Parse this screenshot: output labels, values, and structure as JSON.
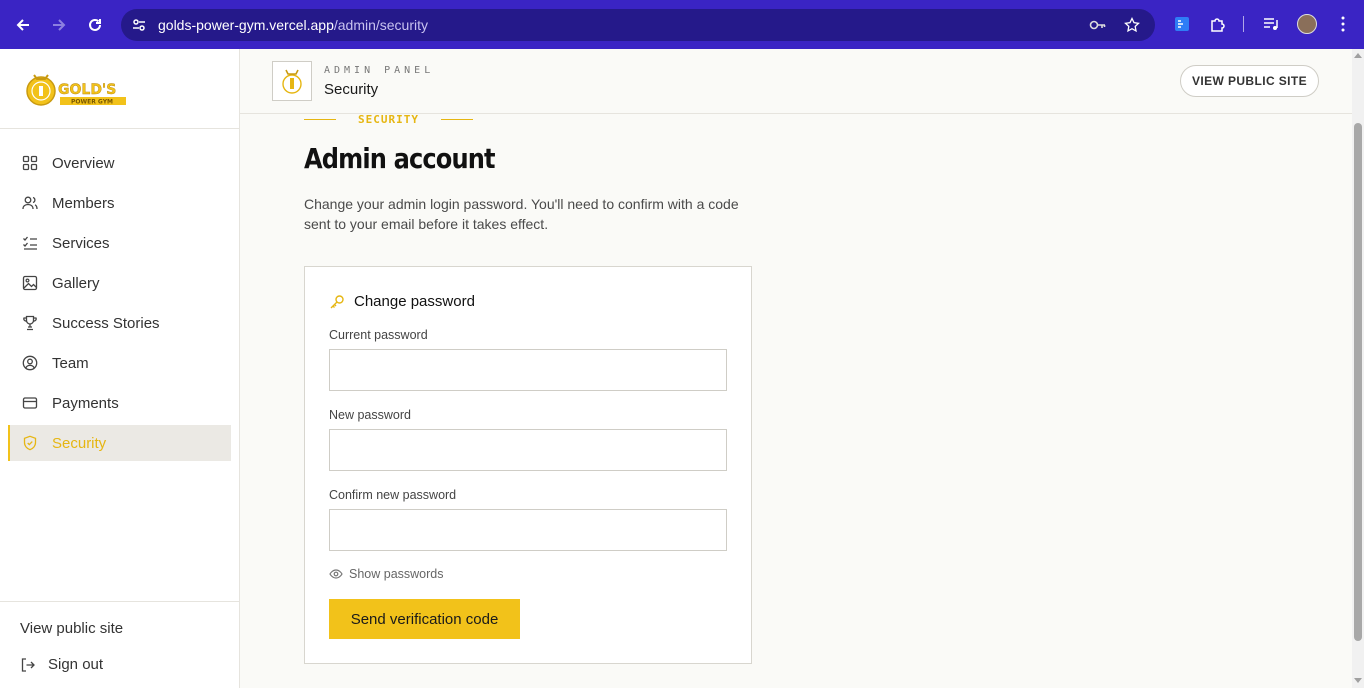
{
  "browser": {
    "url_host": "golds-power-gym.vercel.app",
    "url_path": "/admin/security"
  },
  "sidebar": {
    "logo_text": "GOLD'S",
    "logo_subtext": "POWER GYM",
    "items": [
      {
        "label": "Overview",
        "icon": "grid-icon"
      },
      {
        "label": "Members",
        "icon": "users-icon"
      },
      {
        "label": "Services",
        "icon": "list-check-icon"
      },
      {
        "label": "Gallery",
        "icon": "image-icon"
      },
      {
        "label": "Success Stories",
        "icon": "trophy-icon"
      },
      {
        "label": "Team",
        "icon": "user-circle-icon"
      },
      {
        "label": "Payments",
        "icon": "credit-card-icon"
      },
      {
        "label": "Security",
        "icon": "shield-icon",
        "active": true
      }
    ],
    "footer": {
      "view_public": "View public site",
      "sign_out": "Sign out"
    }
  },
  "header": {
    "kicker": "ADMIN PANEL",
    "title": "Security",
    "view_public_button": "VIEW PUBLIC SITE"
  },
  "main": {
    "eyebrow": "SECURITY",
    "title": "Admin account",
    "description": "Change your admin login password. You'll need to confirm with a code sent to your email before it takes effect.",
    "form": {
      "heading": "Change password",
      "current_label": "Current password",
      "current_value": "",
      "new_label": "New password",
      "new_value": "",
      "confirm_label": "Confirm new password",
      "confirm_value": "",
      "show_passwords": "Show passwords",
      "submit": "Send verification code"
    }
  },
  "colors": {
    "accent": "#f2c21a",
    "chrome": "#3a24c4",
    "omnibox": "#25198a"
  }
}
